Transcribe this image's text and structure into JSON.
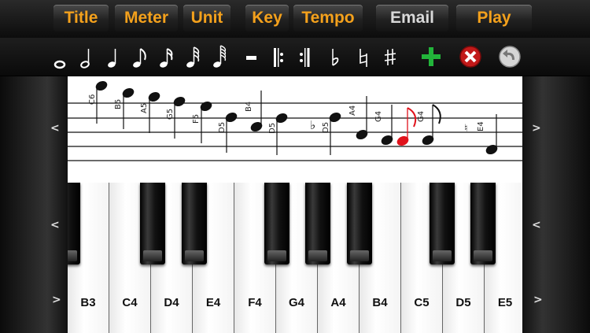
{
  "menu": {
    "title": "Title",
    "meter": "Meter",
    "unit": "Unit",
    "key": "Key",
    "tempo": "Tempo",
    "email": "Email",
    "play": "Play"
  },
  "toolbar": {
    "tools": [
      "whole-note-icon",
      "half-note-icon",
      "quarter-note-icon",
      "eighth-note-icon",
      "sixteenth-note-icon",
      "thirty-second-note-icon",
      "sixty-fourth-note-icon",
      "rest-icon",
      "repeat-start-icon",
      "repeat-end-icon",
      "flat-icon",
      "natural-icon",
      "sharp-icon",
      "add-icon",
      "delete-icon",
      "undo-icon"
    ]
  },
  "staff": {
    "note_labels": [
      "C6",
      "B5",
      "A5",
      "G5",
      "F5",
      "D5",
      "B4",
      "D5",
      "D5",
      "A4",
      "G4",
      "G4",
      "E4"
    ],
    "nav_left": "<",
    "nav_right": ">"
  },
  "keyboard": {
    "white_keys": [
      "B3",
      "C4",
      "D4",
      "E4",
      "F4",
      "G4",
      "A4",
      "B4",
      "C5",
      "D5",
      "E5"
    ],
    "nav_left": "<",
    "nav_right": ">"
  },
  "colors": {
    "menu_text": "#f4a11c",
    "accent_red_note": "#e0121b",
    "add_green": "#22b43a"
  }
}
